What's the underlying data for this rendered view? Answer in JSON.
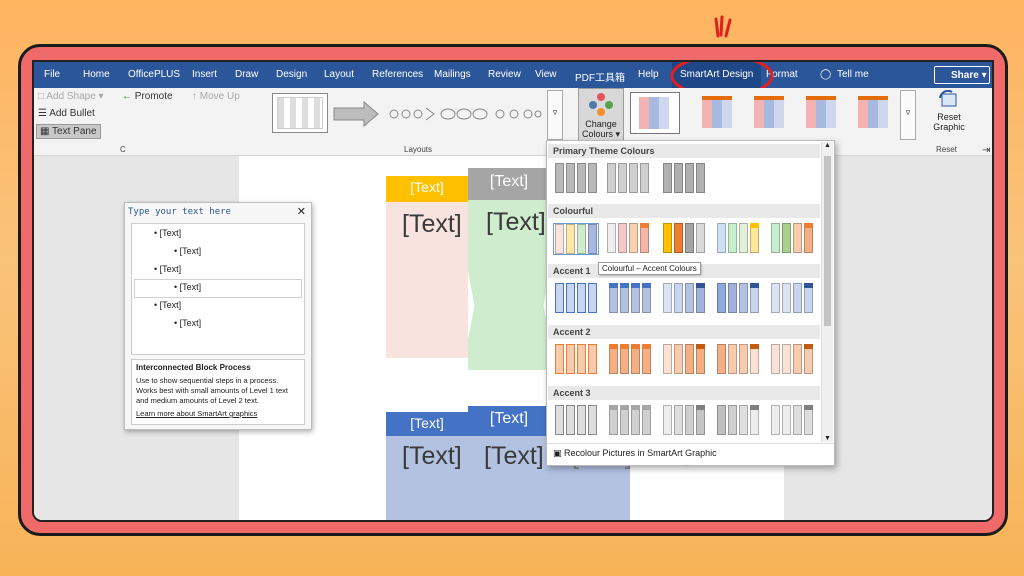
{
  "menu": {
    "tabs": [
      "File",
      "Home",
      "OfficePLUS",
      "Insert",
      "Draw",
      "Design",
      "Layout",
      "References",
      "Mailings",
      "Review",
      "View",
      "PDF工具箱",
      "Help"
    ],
    "active_tab": "SmartArt Design",
    "format_tab": "Format",
    "tell_me": "Tell me",
    "share": "Share"
  },
  "ribbon": {
    "add_shape": "Add Shape",
    "add_bullet": "Add Bullet",
    "text_pane": "Text Pane",
    "promote": "Promote",
    "move_up": "Move Up",
    "layouts_label": "Layouts",
    "change_colours": "Change",
    "change_colours2": "Colours",
    "reset_graphic": "Reset",
    "reset_graphic2": "Graphic",
    "reset_label": "Reset",
    "create_label": "C"
  },
  "text_pane": {
    "title": "Type your text here",
    "items": [
      "[Text]",
      "[Text]",
      "[Text]",
      "[Text]",
      "[Text]",
      "[Text]"
    ],
    "layout_name": "Interconnected Block Process",
    "desc": "Use to show sequential steps in a process. Works best with small amounts of Level 1 text and medium amounts of Level 2 text.",
    "learn_more": "Learn more about SmartArt graphics"
  },
  "canvas": {
    "placeholder": "[Text]"
  },
  "gallery": {
    "sections": [
      "Primary Theme Colours",
      "Colourful",
      "Accent 1",
      "Accent 2",
      "Accent 3"
    ],
    "tooltip": "Colourful – Accent Colours",
    "recolour": "Recolour Pictures in SmartArt Graphic"
  },
  "colors": {
    "word_blue": "#2b579a",
    "highlight": "#e02020",
    "accent_blue": "#4472c4",
    "accent_orange": "#ed7d31",
    "accent_grey": "#a5a5a5",
    "accent_yellow": "#ffc000"
  }
}
